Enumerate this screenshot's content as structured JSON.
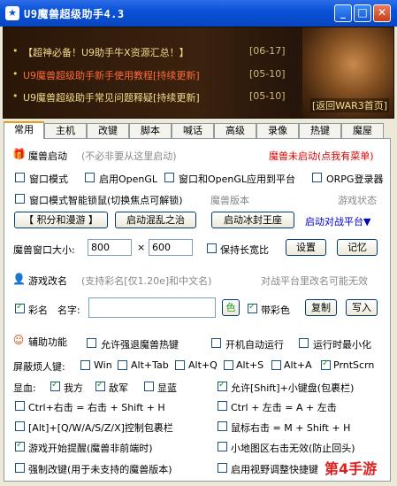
{
  "window": {
    "title": "U9魔兽超级助手4.3",
    "btn_min": "_",
    "btn_max": "□",
    "btn_close": "✕"
  },
  "banner": {
    "news": [
      {
        "text": "【超神必备！U9助手牛X资源汇总！】",
        "date": "[06-17]",
        "highlight": false
      },
      {
        "text": "U9魔兽超级助手新手使用教程[持续更新]",
        "date": "[05-10]",
        "highlight": true
      },
      {
        "text": "U9魔兽超级助手常见问题释疑[持续更新]",
        "date": "[05-10]",
        "highlight": false
      }
    ],
    "back_link": "[返回WAR3首页]"
  },
  "tabs": [
    "常用",
    "主机",
    "改键",
    "脚本",
    "喊话",
    "高级",
    "录像",
    "热键",
    "魔屋"
  ],
  "launch": {
    "title": "魔兽启动",
    "note": "(不必非要从这里启动)",
    "status": "魔兽未启动(点我有菜单)",
    "window_mode": "窗口模式",
    "opengl": "启用OpenGL",
    "window_opengl": "窗口和OpenGL应用到平台",
    "orpg": "ORPG登录器",
    "smart_lock": "窗口模式智能锁鼠(切换焦点可解锁)",
    "version_label": "魔兽版本",
    "game_state": "游戏状态",
    "btn_points": "【 积分和漫游 】",
    "btn_chaos": "启动混乱之治",
    "btn_frozen": "启动冰封王座",
    "platform": "启动对战平台▼",
    "size_label": "魔兽窗口大小:",
    "width": "800",
    "times": "×",
    "height": "600",
    "keep_ratio": "保持长宽比",
    "btn_set": "设置",
    "btn_remember": "记忆"
  },
  "rename": {
    "title": "游戏改名",
    "note": "(支持彩名[仅1.20e]和中文名)",
    "warn": "对战平台里改名可能无效",
    "color_name": "彩名",
    "name_label": "名字:",
    "name_value": "",
    "color_btn": "色",
    "with_color": "带彩色",
    "btn_copy": "复制",
    "btn_write": "写入"
  },
  "aux": {
    "title": "辅助功能",
    "force_hotkey": "允许强退魔兽热键",
    "autorun": "开机自动运行",
    "minimize": "运行时最小化",
    "block_keys": "屏蔽烦人键:",
    "keys": [
      "Win",
      "Alt+Tab",
      "Alt+Q",
      "Alt+S",
      "Alt+A",
      "PrntScrn"
    ],
    "hp_label": "显血:",
    "our_side": "我方",
    "enemy": "敌军",
    "show_blue": "显蓝",
    "shift_keypad": "允许[Shift]+小键盘(包裹栏)",
    "ctrl_right": "Ctrl+右击 = 右击 + Shift + H",
    "ctrl_left": "Ctrl + 左击 = A + 左击",
    "alt_inventory": "[Alt]+[Q/W/A/S/Z/X]控制包裹栏",
    "mouse_right": "鼠标右击 = M + Shift + H",
    "game_start_alert": "游戏开始提醒(魔兽非前端时)",
    "minimap": "小地图区右击无效(防止回头)",
    "force_remap": "强制改键(用于未支持的魔兽版本)",
    "view_hotkey": "启用视野调整快捷键"
  },
  "watermark": "第4手游",
  "colors": {
    "title_blue": "#0a52d8",
    "status_red": "#e00000",
    "link_blue": "#0000cc",
    "check_green": "#21a121",
    "tab_active_accent": "#e89c1c"
  }
}
